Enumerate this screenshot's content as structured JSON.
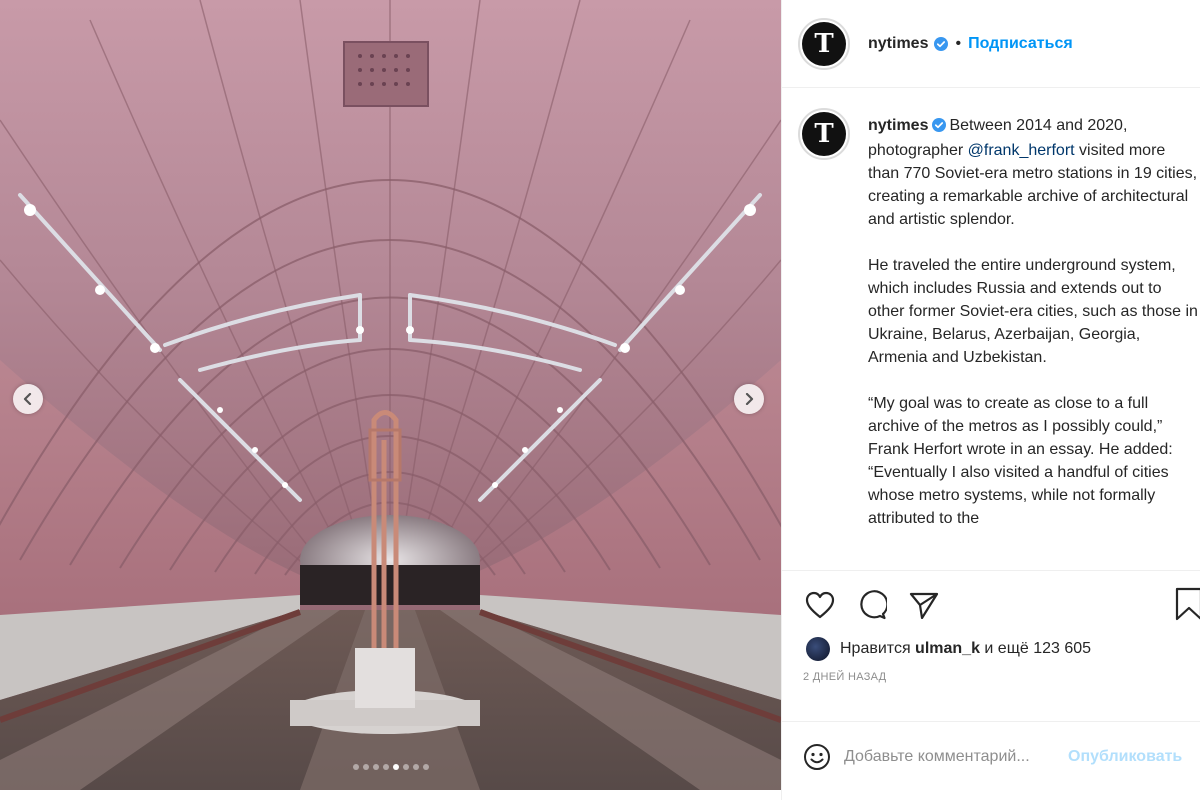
{
  "post": {
    "username": "nytimes",
    "follow_label": "Подписаться",
    "separator": "•",
    "avatar_letter": "T"
  },
  "caption": {
    "username": "nytimes",
    "p1_before": "Between 2014 and 2020, photographer ",
    "p1_mention": "@frank_herfort",
    "p1_after": " visited more than 770 Soviet-era metro stations in 19 cities, creating a remarkable archive of architectural and artistic splendor.",
    "p2": "He traveled the entire underground system, which includes Russia and extends out to other former Soviet-era cities, such as those in Ukraine, Belarus, Azerbaijan, Georgia, Armenia and Uzbekistan.",
    "p3": "“My goal was to create as close to a full archive of the metros as I possibly could,” Frank Herfort wrote in an essay. He added: “Eventually I also visited a handful of cities whose metro systems, while not formally attributed to the"
  },
  "likes": {
    "prefix": "Нравится ",
    "user": "ulman_k",
    "suffix": " и ещё 123 605"
  },
  "timestamp": "2 ДНЕЙ НАЗАД",
  "comment": {
    "placeholder": "Добавьте комментарий...",
    "publish_label": "Опубликовать"
  },
  "carousel": {
    "total": 8,
    "active_index": 4
  },
  "icons": {
    "verified": "verified-badge-icon",
    "like": "heart-icon",
    "comment": "comment-icon",
    "share": "paper-plane-icon",
    "save": "bookmark-icon",
    "emoji": "smiley-icon",
    "prev": "chevron-left-icon",
    "next": "chevron-right-icon"
  },
  "colors": {
    "accent": "#0095f6",
    "verified": "#3897f0",
    "publish_disabled": "#b2dffc",
    "muted": "#8e8e8e"
  }
}
